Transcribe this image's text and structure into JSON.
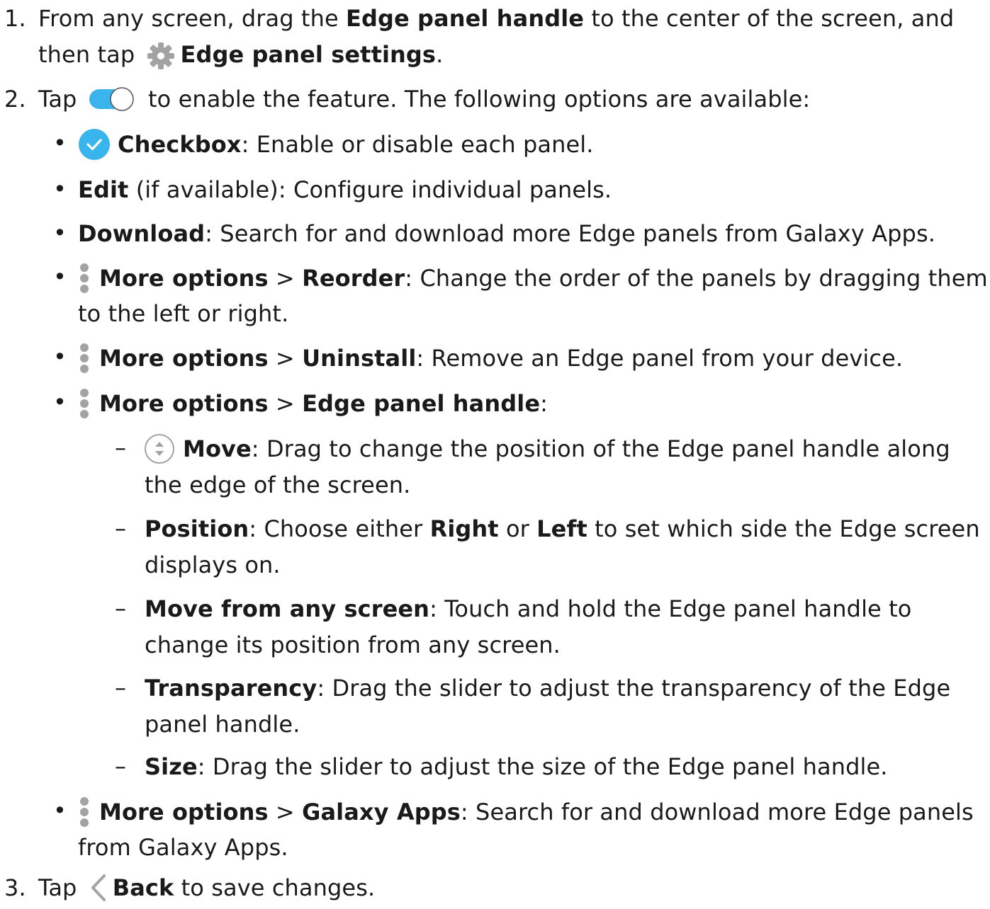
{
  "step1": {
    "number": "1.",
    "text_a": "From any screen, drag the ",
    "bold_a": "Edge panel handle",
    "text_b": " to the center of the screen, and",
    "text_c": "then tap ",
    "bold_b": "Edge panel settings",
    "text_d": "."
  },
  "step2": {
    "number": "2.",
    "text_a": "Tap ",
    "text_b": " to enable the feature. The following options are available:"
  },
  "options": {
    "checkbox": {
      "bold": "Checkbox",
      "text": ": Enable or disable each panel."
    },
    "edit": {
      "bold": "Edit",
      "text": " (if available): Configure individual panels."
    },
    "download": {
      "bold": "Download",
      "text": ": Search for and download more Edge panels from Galaxy Apps."
    },
    "reorder": {
      "bold_a": "More options",
      "sep": " > ",
      "bold_b": "Reorder",
      "text_a": ": Change the order of the panels by dragging them",
      "text_b": "to the left or right."
    },
    "uninstall": {
      "bold_a": "More options",
      "sep": " > ",
      "bold_b": "Uninstall",
      "text": ": Remove an Edge panel from your device."
    },
    "handle": {
      "bold_a": "More options",
      "sep": " > ",
      "bold_b": "Edge panel handle",
      "text": ":"
    },
    "galaxy": {
      "bold_a": "More options",
      "sep": " > ",
      "bold_b": "Galaxy Apps",
      "text_a": ": Search for and download more Edge panels",
      "text_b": "from Galaxy Apps."
    }
  },
  "handle_options": {
    "move": {
      "bold": "Move",
      "text_a": ": Drag to change the position of the Edge panel handle along",
      "text_b": "the edge of the screen."
    },
    "position": {
      "bold_a": "Position",
      "text_a": ": Choose either ",
      "bold_b": "Right",
      "text_b": " or ",
      "bold_c": "Left",
      "text_c": " to set which side the Edge screen",
      "text_d": "displays on."
    },
    "move_any": {
      "bold": "Move from any screen",
      "text_a": ": Touch and hold the Edge panel handle to",
      "text_b": "change its position from any screen."
    },
    "transparency": {
      "bold": "Transparency",
      "text_a": ": Drag the slider to adjust the transparency of the Edge",
      "text_b": "panel handle."
    },
    "size": {
      "bold": "Size",
      "text": ": Drag the slider to adjust the size of the Edge panel handle."
    }
  },
  "step3": {
    "number": "3.",
    "text_a": "Tap ",
    "bold": "Back",
    "text_b": " to save changes."
  },
  "symbols": {
    "bullet": "•",
    "dash": "–"
  },
  "icons": {
    "gear": "gear-icon",
    "toggle": "toggle-on-icon",
    "check": "checkbox-checked-icon",
    "more": "more-options-icon",
    "move": "move-arrows-icon",
    "back": "back-chevron-icon"
  },
  "colors": {
    "text": "#1a1a1a",
    "accent_blue": "#3ab4ec",
    "icon_gray": "#a3a3a3"
  }
}
